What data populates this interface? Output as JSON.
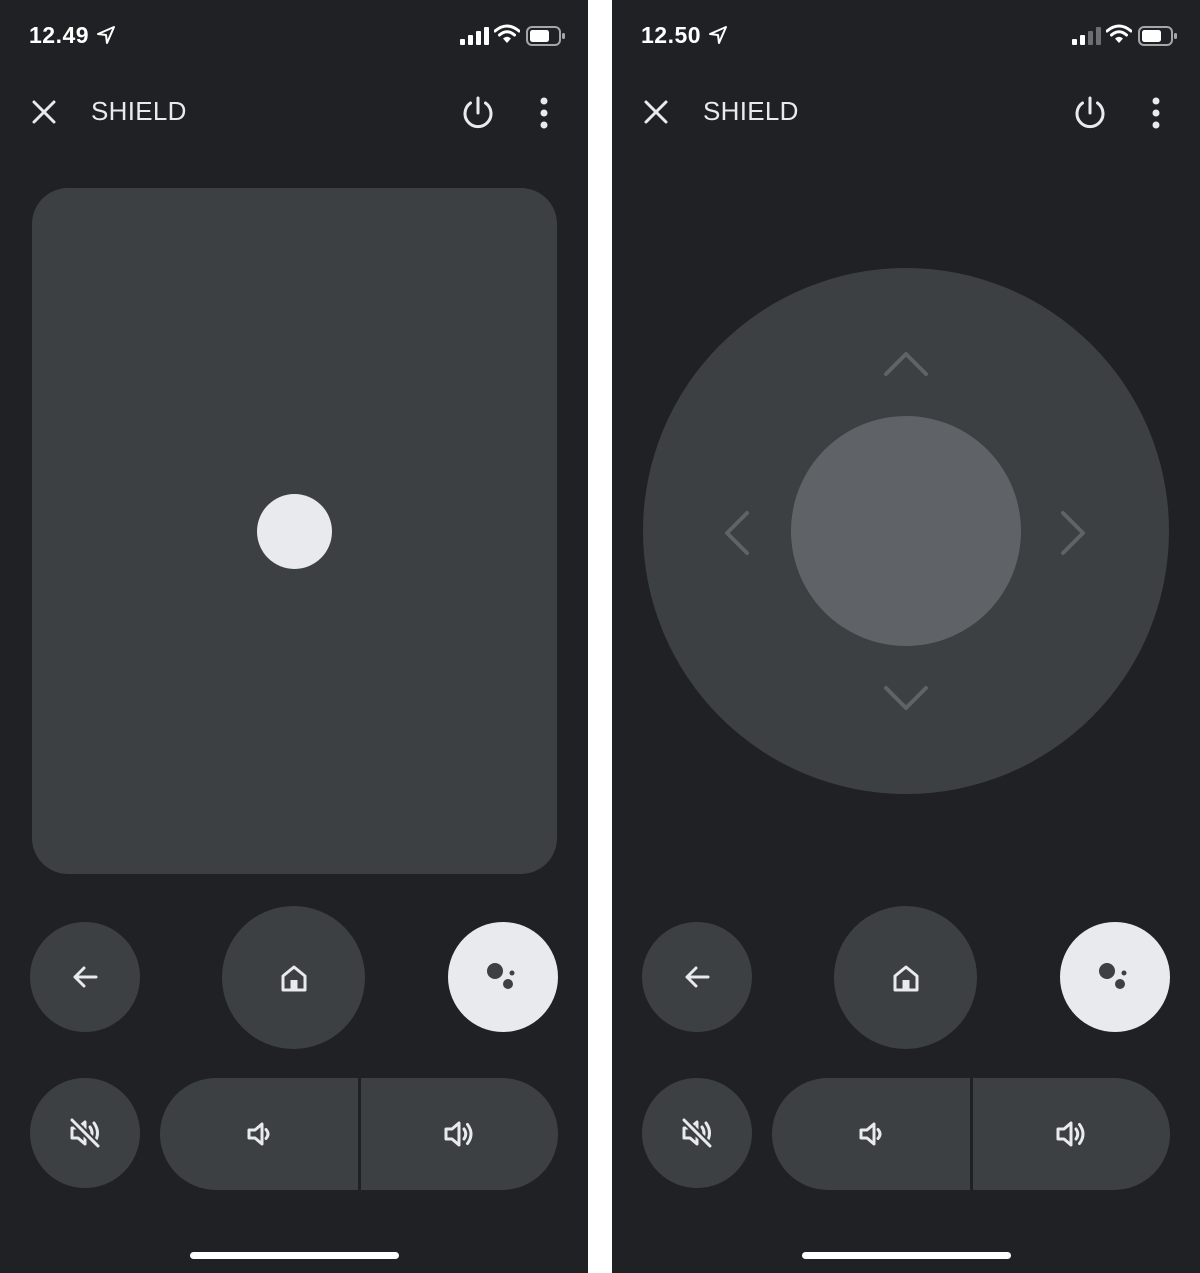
{
  "screens": [
    {
      "status": {
        "time": "12.49",
        "signal_bars": 4
      },
      "app_bar": {
        "title": "SHIELD"
      },
      "mode": "touchpad"
    },
    {
      "status": {
        "time": "12.50",
        "signal_bars": 2
      },
      "app_bar": {
        "title": "SHIELD"
      },
      "mode": "dpad"
    }
  ],
  "icons": {
    "close": "close-icon",
    "power": "power-icon",
    "more": "more-vert-icon",
    "back": "arrow-back-icon",
    "home": "home-icon",
    "assistant": "google-assistant-icon",
    "mute": "volume-off-icon",
    "volume_down": "volume-down-icon",
    "volume_up": "volume-up-icon"
  },
  "colors": {
    "background": "#202124",
    "surface": "#3c4043",
    "dpad_center": "#5f6368",
    "accent_light": "#e8eaed"
  }
}
